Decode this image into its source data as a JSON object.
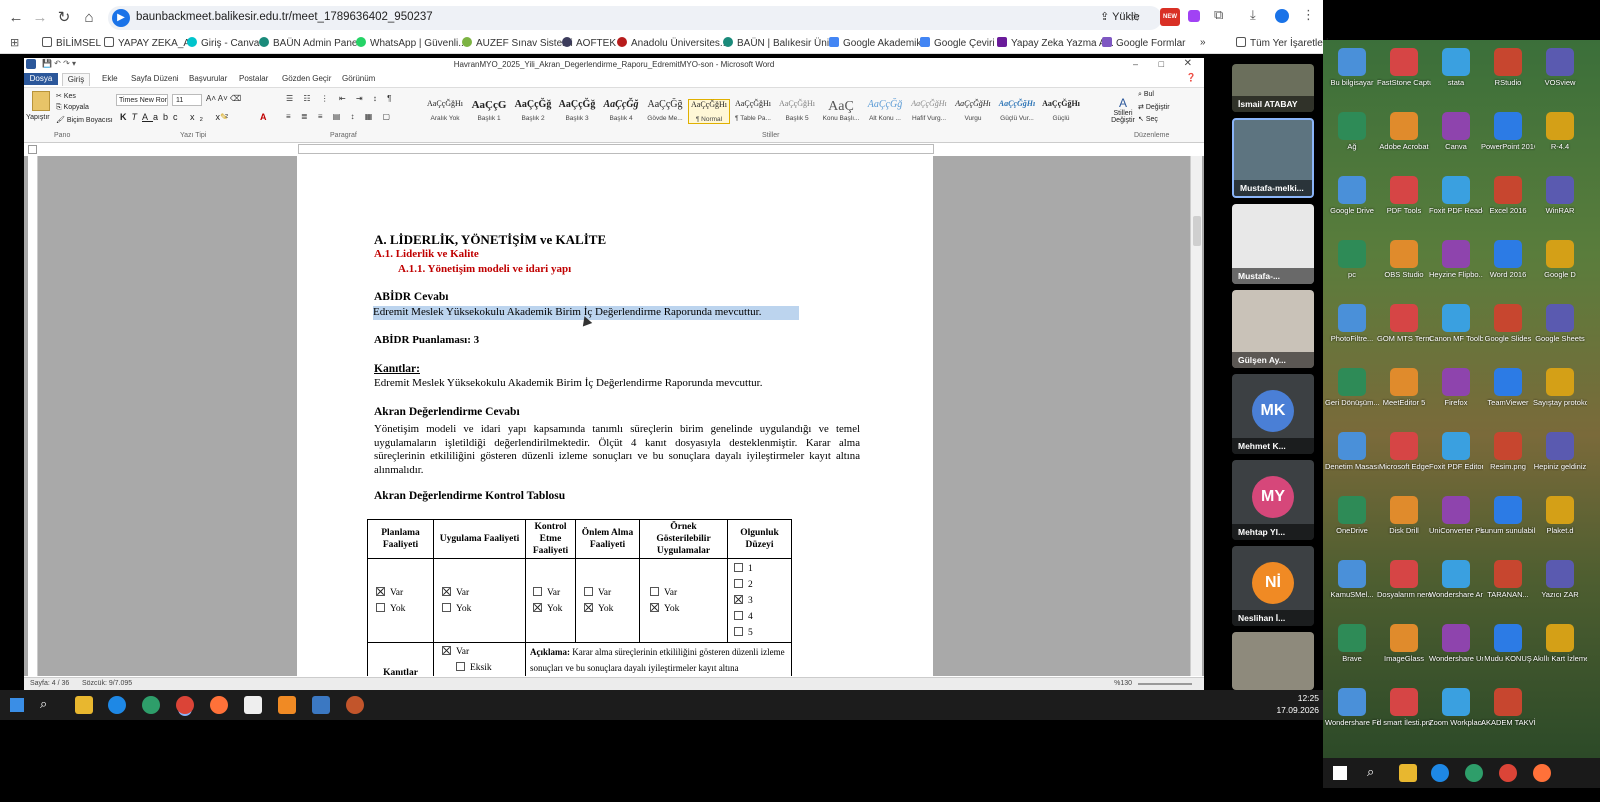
{
  "browser": {
    "url": "baunbackmeet.balikesir.edu.tr/meet_1789636402_950237",
    "upload_label": "Yükle",
    "new_badge": "NEW",
    "bookmarks": [
      "BİLİMSEL",
      "YAPAY ZEKA_AI",
      "Giriş - Canva",
      "BAÜN Admin Panel",
      "WhatsApp | Güvenli...",
      "AUZEF Sınav Sistemi",
      "AOFTEK",
      "Anadolu Üniversites...",
      "BAÜN | Balıkesir Üni...",
      "Google Akademik",
      "Google Çeviri",
      "Yapay Zeka Yazma A...",
      "Google Formlar"
    ],
    "bookmarks_more": "»",
    "other_bookmarks": "Tüm Yer İşaretleri"
  },
  "word": {
    "title": "HavranMYO_2025_Yili_Akran_Degerlendirme_Raporu_EdremitMYO-son  -  Microsoft Word",
    "tabs": [
      "Dosya",
      "Giriş",
      "Ekle",
      "Sayfa Düzeni",
      "Başvurular",
      "Postalar",
      "Gözden Geçir",
      "Görünüm"
    ],
    "clipboard": {
      "paste": "Yapıştır",
      "cut": "Kes",
      "copy": "Kopyala",
      "format_painter": "Biçim Boyacısı"
    },
    "font_name": "Times New Ror",
    "font_size": "11",
    "styles": [
      {
        "preview": "AaÇçĞğHı",
        "name": "Aralık Yok"
      },
      {
        "preview": "AaÇçG",
        "name": "Başlık 1"
      },
      {
        "preview": "AaÇçĞğ",
        "name": "Başlık 2"
      },
      {
        "preview": "AaÇçĞğ",
        "name": "Başlık 3"
      },
      {
        "preview": "AaÇçĞğ",
        "name": "Başlık 4"
      },
      {
        "preview": "AaÇçĞğ",
        "name": "Gövde Me..."
      },
      {
        "preview": "AaÇçĞğHı",
        "name": "¶ Normal"
      },
      {
        "preview": "AaÇçĞğHı",
        "name": "¶ Table Pa..."
      },
      {
        "preview": "AaÇçĞğHı",
        "name": "Başlık 5"
      },
      {
        "preview": "AaÇ",
        "name": "Konu Başlı..."
      },
      {
        "preview": "AaÇçĞğ",
        "name": "Alt Konu ..."
      },
      {
        "preview": "AaÇçĞğHı",
        "name": "Hafif Vurg..."
      },
      {
        "preview": "AaÇçĞğHı",
        "name": "Vurgu"
      },
      {
        "preview": "AaÇçĞğHı",
        "name": "Güçlü Vur..."
      },
      {
        "preview": "AaÇçĞğHı",
        "name": "Güçlü"
      }
    ],
    "change_styles": "Stilleri Değiştir",
    "editing": {
      "find": "Bul",
      "replace": "Değiştir",
      "select": "Seç"
    },
    "groups": {
      "clipboard": "Pano",
      "font": "Yazı Tipi",
      "paragraph": "Paragraf",
      "styles": "Stiller",
      "editing": "Düzenleme"
    },
    "status": {
      "page": "Sayfa: 4 / 36",
      "words": "Sözcük: 9/7.095",
      "zoom": "%130"
    }
  },
  "doc": {
    "h1": "A. LİDERLİK, YÖNETİŞİM ve KALİTE",
    "h2": "A.1. Liderlik ve Kalite",
    "h3": "A.1.1. Yönetişim modeli ve idari yapı",
    "abidr_title": "ABİDR Cevabı",
    "abidr_text": "Edremit Meslek Yüksekokulu Akademik Birim İç Değerlendirme Raporunda mevcuttur.",
    "score": "ABİDR Puanlaması: 3",
    "evidence_title": "Kanıtlar:",
    "evidence_text": "Edremit Meslek Yüksekokulu Akademik Birim İç Değerlendirme Raporunda mevcuttur.",
    "peer_title": "Akran Değerlendirme Cevabı",
    "peer_text": "Yönetişim modeli ve idari yapı kapsamında tanımlı süreçlerin birim genelinde uygulandığı ve temel uygulamaların işletildiği değerlendirilmektedir. Ölçüt 4 kanıt dosyasıyla desteklenmiştir. Karar alma süreçlerinin etkililiğini gösteren düzenli izleme sonuçları ve bu sonuçlara dayalı iyileştirmeler kayıt altına alınmalıdır.",
    "control_title": "Akran Değerlendirme Kontrol Tablosu",
    "table": {
      "headers": [
        "Planlama Faaliyeti",
        "Uygulama Faaliyeti",
        "Kontrol Etme Faaliyeti",
        "Önlem Alma Faaliyeti",
        "Örnek Gösterilebilir Uygulamalar",
        "Olgunluk Düzeyi"
      ],
      "var": "Var",
      "yok": "Yok",
      "levels": [
        "1",
        "2",
        "3",
        "4",
        "5"
      ],
      "evidence_label": "Kanıtlar",
      "eksik": "Eksik",
      "aciklama_label": "Açıklama:",
      "aciklama_text": "Karar alma süreçlerinin etkililiğini gösteren düzenli izleme sonuçları ve bu sonuçlara dayalı iyileştirmeler kayıt altına"
    }
  },
  "taskbar": {
    "time": "12:25",
    "date": "17.09.2026"
  },
  "meet": {
    "participants": [
      {
        "name": "İsmail ATABAY"
      },
      {
        "name": "Mustafa-melki..."
      },
      {
        "name": "Mustafa-..."
      },
      {
        "name": "Gülşen Ay..."
      },
      {
        "initials": "MK",
        "name": "Mehmet K...",
        "color": "#4a7fd6"
      },
      {
        "initials": "MY",
        "name": "Mehtap YI...",
        "color": "#d6477a"
      },
      {
        "initials": "Nİ",
        "name": "Neslihan İ...",
        "color": "#f08a24"
      }
    ]
  },
  "desktop": {
    "icons": [
      "Bu bilgisayar",
      "FastStone Capture",
      "stata",
      "RStudio",
      "VOSview",
      "Ağ",
      "Adobe Acrobat",
      "Canva",
      "PowerPoint 2016",
      "R-4.4",
      "Google Drive",
      "PDF Tools",
      "Foxit PDF Reader",
      "Excel 2016",
      "WinRAR",
      "pc",
      "OBS Studio",
      "Heyzine Flipbo...",
      "Word 2016",
      "Google D",
      "PhotoFiltre...",
      "GOM MTS Terminal",
      "Canon MF Toolbox 4.9",
      "Google Slides",
      "Google Sheets",
      "Geri Dönüşüm...",
      "MeetEditor 5",
      "Firefox",
      "TeamViewer",
      "Sayıştay protokol",
      "Denetim Masası",
      "Microsoft Edge",
      "Foxit PDF Editor",
      "Resim.png",
      "Hepiniz geldiniz",
      "OneDrive",
      "Disk Drill",
      "UniConverter Player",
      "sunum sunulabil...",
      "Plaket.d",
      "KamuSMel...",
      "Dosyalarım nerede",
      "Wondershare Anireel",
      "TARANAN...",
      "Yazıcı ZAR",
      "Brave",
      "ImageGlass",
      "Wondershare UniConvert...",
      "Mudu KONUŞ",
      "Akıllı Kart İzleme Aracı",
      "Wondershare Filmora 13",
      "d smart İlesti.png",
      "Zoom Workplace",
      "AKADEM TAKVİM"
    ]
  }
}
